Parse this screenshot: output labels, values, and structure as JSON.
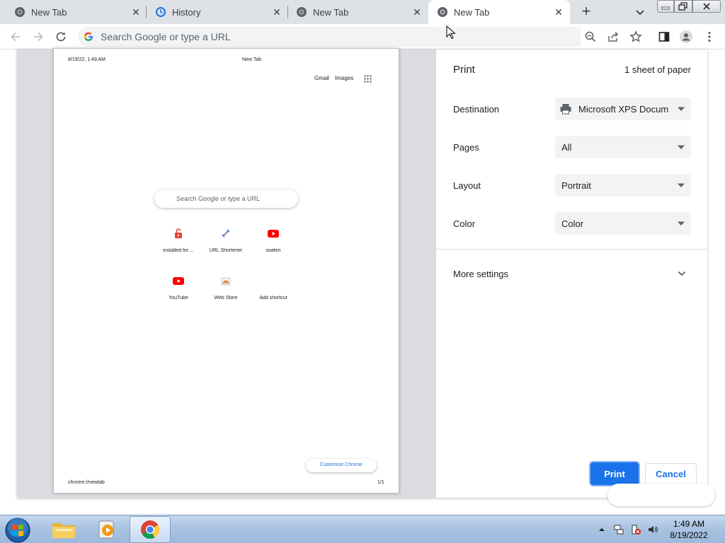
{
  "tabs": [
    {
      "title": "New Tab",
      "icon": "chrome-icon",
      "active": false
    },
    {
      "title": "History",
      "icon": "history-icon",
      "active": false
    },
    {
      "title": "New Tab",
      "icon": "chrome-icon",
      "active": false
    },
    {
      "title": "New Tab",
      "icon": "chrome-icon",
      "active": true
    }
  ],
  "toolbar": {
    "omnibox_placeholder": "Search Google or type a URL"
  },
  "preview": {
    "header_date": "8/19/22, 1:49 AM",
    "header_title": "New Tab",
    "gmail": "Gmail",
    "images": "Images",
    "search_placeholder": "Search Google or type a URL",
    "shortcuts": [
      {
        "label": "installed for ...",
        "icon": "lock-icon"
      },
      {
        "label": "URL Shortener",
        "icon": "link-icon"
      },
      {
        "label": "soafen",
        "icon": "youtube-icon"
      },
      {
        "label": "YouTube",
        "icon": "youtube-icon"
      },
      {
        "label": "Web Store",
        "icon": "web-store-icon"
      },
      {
        "label": "Add shortcut",
        "icon": "add-icon"
      }
    ],
    "customize": "Customize Chrome",
    "footer_url": "chrome://newtab",
    "footer_page": "1/1"
  },
  "print": {
    "title": "Print",
    "sheets": "1 sheet of paper",
    "settings": [
      {
        "label": "Destination",
        "value": "Microsoft XPS Docum"
      },
      {
        "label": "Pages",
        "value": "All"
      },
      {
        "label": "Layout",
        "value": "Portrait"
      },
      {
        "label": "Color",
        "value": "Color"
      }
    ],
    "more_settings": "More settings",
    "print_button": "Print",
    "cancel_button": "Cancel"
  },
  "taskbar": {
    "time": "1:49 AM",
    "date": "8/19/2022"
  },
  "colors": {
    "accent": "#1a73e8",
    "tabstrip": "#dee1e6",
    "overlay": "#dadce0"
  }
}
